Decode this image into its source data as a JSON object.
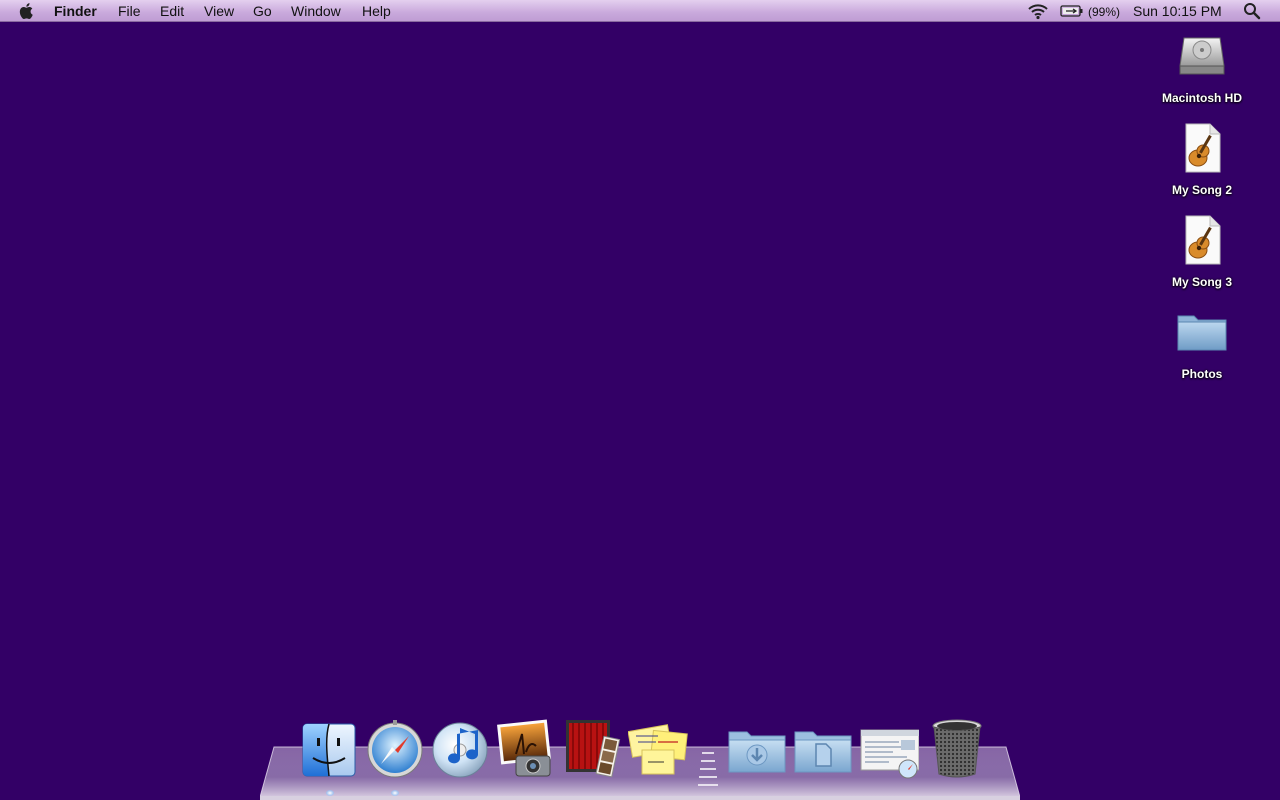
{
  "menubar": {
    "app_name": "Finder",
    "menus": [
      "File",
      "Edit",
      "View",
      "Go",
      "Window",
      "Help"
    ],
    "battery_percent": "(99%)",
    "clock": "Sun 10:15 PM",
    "icons": [
      "apple-icon",
      "wifi-icon",
      "battery-icon",
      "spotlight-icon"
    ]
  },
  "desktop": {
    "background_color": "#330066",
    "icons": [
      {
        "label": "Macintosh HD",
        "icon": "hard-drive-icon"
      },
      {
        "label": "My Song 2",
        "icon": "garageband-document-icon"
      },
      {
        "label": "My Song 3",
        "icon": "garageband-document-icon"
      },
      {
        "label": "Photos",
        "icon": "folder-icon"
      }
    ]
  },
  "dock": {
    "items": [
      {
        "name": "Finder",
        "icon": "finder-icon",
        "running": true
      },
      {
        "name": "Safari",
        "icon": "safari-icon",
        "running": true
      },
      {
        "name": "iTunes",
        "icon": "itunes-icon",
        "running": false
      },
      {
        "name": "iPhoto",
        "icon": "iphoto-icon",
        "running": false
      },
      {
        "name": "Photo Booth",
        "icon": "photo-booth-icon",
        "running": false
      },
      {
        "name": "Stickies",
        "icon": "stickies-icon",
        "running": false
      },
      {
        "name": "Downloads",
        "icon": "downloads-folder-icon",
        "running": false
      },
      {
        "name": "Documents",
        "icon": "documents-folder-icon",
        "running": false
      },
      {
        "name": "Web Page",
        "icon": "webpage-icon",
        "running": false
      },
      {
        "name": "Trash",
        "icon": "trash-icon",
        "running": false
      }
    ]
  }
}
